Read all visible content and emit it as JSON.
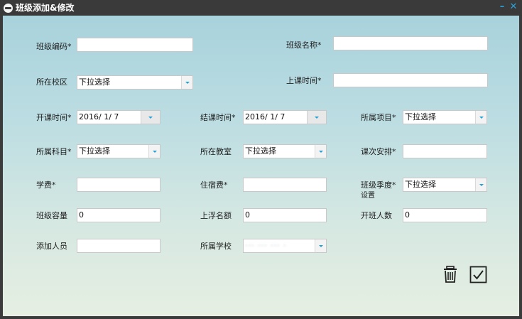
{
  "window": {
    "title": "班级添加&修改",
    "minimize": "–",
    "close": "✕"
  },
  "form": {
    "class_code": {
      "label": "班级编码*",
      "value": ""
    },
    "class_name": {
      "label": "班级名称*",
      "value": ""
    },
    "campus": {
      "label": "所在校区",
      "value": "下拉选择"
    },
    "class_time": {
      "label": "上课时间*",
      "value": ""
    },
    "start_date": {
      "label": "开课时间*",
      "value": "2016/  1/  7"
    },
    "end_date": {
      "label": "结课时间*",
      "value": "2016/  1/  7"
    },
    "project": {
      "label": "所属项目*",
      "value": "下拉选择"
    },
    "subject": {
      "label": "所属科目*",
      "value": "下拉选择"
    },
    "classroom": {
      "label": "所在教室",
      "value": "下拉选择"
    },
    "lessons": {
      "label": "课次安排*",
      "value": ""
    },
    "tuition": {
      "label": "学费*",
      "value": ""
    },
    "lodging": {
      "label": "住宿费*",
      "value": ""
    },
    "season": {
      "label": "班级季度*",
      "label2": "设置",
      "value": "下拉选择"
    },
    "capacity": {
      "label": "班级容量",
      "value": "0"
    },
    "overflow": {
      "label": "上浮名额",
      "value": "0"
    },
    "min_open": {
      "label": "开班人数",
      "value": "0"
    },
    "added_by": {
      "label": "添加人员",
      "value": ""
    },
    "school": {
      "label": "所属学校",
      "value": "··· ··· ··· ·"
    }
  },
  "actions": {
    "delete_icon": "trash-icon",
    "confirm_icon": "checkmark-icon"
  },
  "colors": {
    "titlebar": "#3a3a3a",
    "accent": "#2a9fd6",
    "bg_top": "#a8d2dc",
    "bg_bottom": "#e6efe2"
  }
}
